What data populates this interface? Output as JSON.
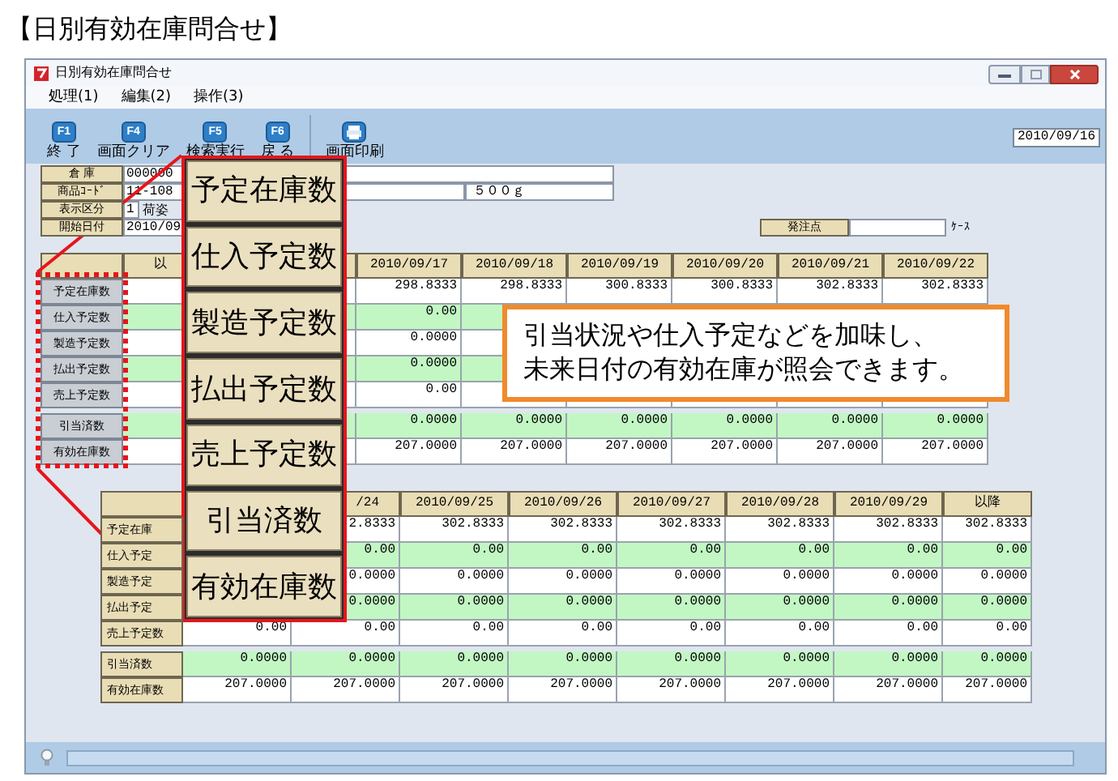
{
  "heading": "【日別有効在庫問合せ】",
  "window": {
    "title": "日別有効在庫問合せ"
  },
  "menu": [
    "処理(1)",
    "編集(2)",
    "操作(3)"
  ],
  "toolbar": [
    {
      "kind": "key",
      "key": "F1",
      "label": "終 了"
    },
    {
      "kind": "key",
      "key": "F4",
      "label": "画面クリア"
    },
    {
      "kind": "key",
      "key": "F5",
      "label": "検索実行"
    },
    {
      "kind": "key",
      "key": "F6",
      "label": "戻 る"
    },
    {
      "kind": "print",
      "label": "画面印刷"
    }
  ],
  "toolbar_date": "2010/09/16",
  "form": [
    {
      "kind": "wide",
      "label": "倉 庫",
      "value": "000000"
    },
    {
      "kind": "code",
      "label": "商品ｺｰﾄﾞ",
      "value": "11-108",
      "extra": "５００ｇ"
    },
    {
      "kind": "option",
      "label": "表示区分",
      "value": "1",
      "extra": "荷姿"
    },
    {
      "kind": "date",
      "label": "開始日付",
      "value": "2010/09"
    }
  ],
  "order_point": {
    "label": "発注点",
    "unit": "ｹｰｽ"
  },
  "upper_grid": {
    "kind": "button",
    "columns": [
      "以",
      null,
      "2010/09/17",
      "2010/09/18",
      "2010/09/19",
      "2010/09/20",
      "2010/09/21",
      "2010/09/22"
    ],
    "rows": [
      {
        "label": "予定在庫数",
        "highlighted": false,
        "separated": false,
        "cells": [
          null,
          null,
          "298.8333",
          "298.8333",
          "300.8333",
          "300.8333",
          "302.8333",
          "302.8333"
        ]
      },
      {
        "label": "仕入予定数",
        "highlighted": true,
        "separated": false,
        "cells": [
          null,
          null,
          "0.00",
          null,
          null,
          null,
          null,
          null
        ]
      },
      {
        "label": "製造予定数",
        "highlighted": false,
        "separated": false,
        "cells": [
          null,
          null,
          "0.0000",
          null,
          null,
          null,
          null,
          null
        ]
      },
      {
        "label": "払出予定数",
        "highlighted": true,
        "separated": false,
        "cells": [
          null,
          null,
          "0.0000",
          null,
          null,
          null,
          null,
          null
        ]
      },
      {
        "label": "売上予定数",
        "highlighted": false,
        "separated": false,
        "cells": [
          null,
          null,
          "0.00",
          null,
          null,
          null,
          null,
          null
        ]
      },
      {
        "label": "引当済数",
        "highlighted": true,
        "separated": true,
        "cells": [
          null,
          null,
          "0.0000",
          "0.0000",
          "0.0000",
          "0.0000",
          "0.0000",
          "0.0000"
        ]
      },
      {
        "label": "有効在庫数",
        "highlighted": false,
        "separated": false,
        "cells": [
          null,
          null,
          "207.0000",
          "207.0000",
          "207.0000",
          "207.0000",
          "207.0000",
          "207.0000"
        ]
      }
    ]
  },
  "lower_grid": {
    "kind": "plain",
    "columns": [
      null,
      "/24",
      "2010/09/25",
      "2010/09/26",
      "2010/09/27",
      "2010/09/28",
      "2010/09/29",
      "以降"
    ],
    "rows": [
      {
        "label": "予定在庫",
        "highlighted": false,
        "separated": false,
        "cells": [
          null,
          "2.8333",
          "302.8333",
          "302.8333",
          "302.8333",
          "302.8333",
          "302.8333",
          "302.8333"
        ]
      },
      {
        "label": "仕入予定",
        "highlighted": true,
        "separated": false,
        "cells": [
          null,
          "0.00",
          "0.00",
          "0.00",
          "0.00",
          "0.00",
          "0.00",
          "0.00"
        ]
      },
      {
        "label": "製造予定",
        "highlighted": false,
        "separated": false,
        "cells": [
          null,
          "0.0000",
          "0.0000",
          "0.0000",
          "0.0000",
          "0.0000",
          "0.0000",
          "0.0000"
        ]
      },
      {
        "label": "払出予定",
        "highlighted": true,
        "separated": false,
        "cells": [
          null,
          "0.0000",
          "0.0000",
          "0.0000",
          "0.0000",
          "0.0000",
          "0.0000",
          "0.0000"
        ]
      },
      {
        "label": "売上予定数",
        "highlighted": false,
        "separated": false,
        "cells": [
          "0.00",
          "0.00",
          "0.00",
          "0.00",
          "0.00",
          "0.00",
          "0.00",
          "0.00"
        ]
      },
      {
        "label": "引当済数",
        "highlighted": true,
        "separated": true,
        "cells": [
          "0.0000",
          "0.0000",
          "0.0000",
          "0.0000",
          "0.0000",
          "0.0000",
          "0.0000",
          "0.0000"
        ]
      },
      {
        "label": "有効在庫数",
        "highlighted": false,
        "separated": false,
        "cells": [
          "207.0000",
          "207.0000",
          "207.0000",
          "207.0000",
          "207.0000",
          "207.0000",
          "207.0000",
          "207.0000"
        ]
      }
    ]
  },
  "callout_labels": [
    "予定在庫数",
    "仕入予定数",
    "製造予定数",
    "払出予定数",
    "売上予定数",
    "引当済数",
    "有効在庫数"
  ],
  "callout_lines": [
    "引当状況や仕入予定などを加味し、",
    "未来日付の有効在庫が照会できます。"
  ]
}
